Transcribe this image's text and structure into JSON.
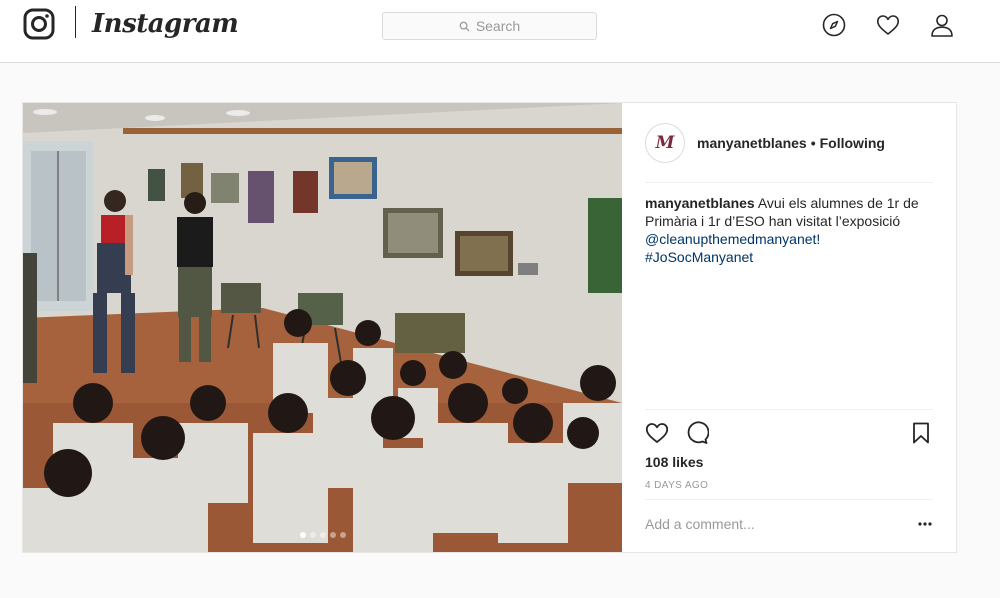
{
  "brand": {
    "wordmark": "Instagram"
  },
  "search": {
    "placeholder": "Search"
  },
  "nav": {
    "icons": [
      "compass-icon",
      "heart-icon",
      "person-icon"
    ]
  },
  "post": {
    "username": "manyanetblanes",
    "follow_status": "Following",
    "separator": "•",
    "avatar_initial": "M",
    "caption": {
      "user": "manyanetblanes",
      "text": "Avui els alumnes de 1r de Primària i 1r d’ESO han visitat l’exposició",
      "mention": "@cleanupthemedmanyanet!",
      "hashtag": "#JoSocManyanet"
    },
    "likes": "108 likes",
    "time_ago": "4 DAYS AGO",
    "comment_placeholder": "Add a comment...",
    "carousel": {
      "count": 5,
      "active_index": 0
    }
  },
  "colors": {
    "link": "#003569",
    "border": "#dbdbdb",
    "background": "#fafafa",
    "muted": "#999999"
  }
}
